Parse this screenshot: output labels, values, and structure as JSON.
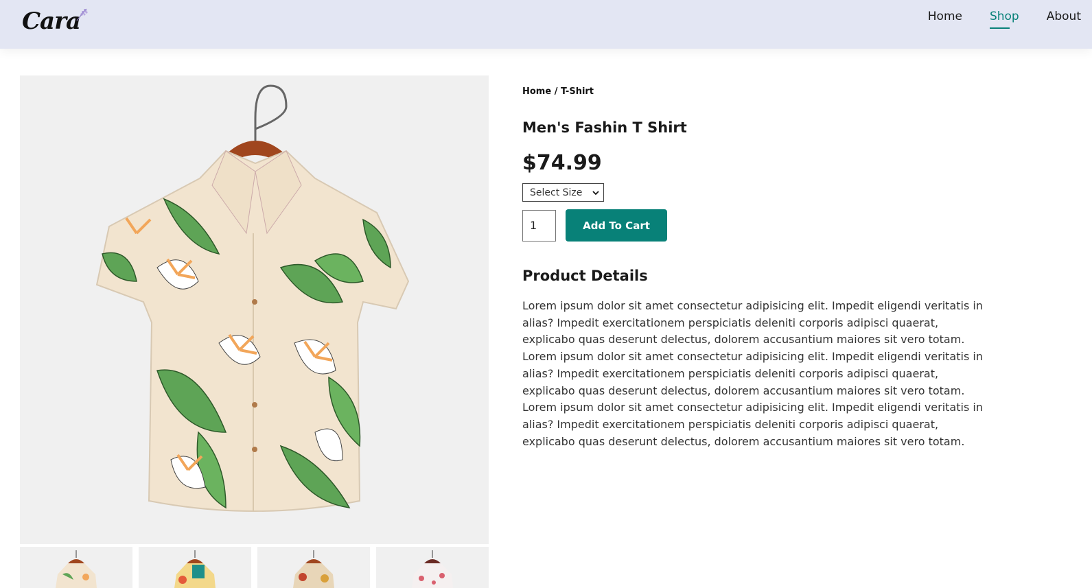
{
  "header": {
    "logo_text": "Cara",
    "nav": [
      {
        "label": "Home",
        "active": false
      },
      {
        "label": "Shop",
        "active": true
      },
      {
        "label": "About",
        "active": false
      }
    ]
  },
  "product": {
    "breadcrumb": "Home / T-Shirt",
    "title": "Men's Fashin T Shirt",
    "price": "$74.99",
    "size_select": {
      "selected": "Select Size"
    },
    "quantity": "1",
    "add_to_cart_label": "Add To Cart",
    "details_heading": "Product Details",
    "description": "Lorem ipsum dolor sit amet consectetur adipisicing elit. Impedit eligendi veritatis in alias? Impedit exercitationem perspiciatis deleniti corporis adipisci quaerat, explicabo quas deserunt delectus, dolorem accusantium maiores sit vero totam. Lorem ipsum dolor sit amet consectetur adipisicing elit. Impedit eligendi veritatis in alias? Impedit exercitationem perspiciatis deleniti corporis adipisci quaerat, explicabo quas deserunt delectus, dolorem accusantium maiores sit vero totam. Lorem ipsum dolor sit amet consectetur adipisicing elit. Impedit eligendi veritatis in alias? Impedit exercitationem perspiciatis deleniti corporis adipisci quaerat, explicabo quas deserunt delectus, dolorem accusantium maiores sit vero totam."
  },
  "colors": {
    "accent": "#088178",
    "header_bg": "#e3e6f3",
    "image_bg": "#f0f0f0"
  },
  "icons": {
    "dropdown": "chevron-down-icon",
    "logo_sprig": "lavender-sprig-icon"
  }
}
